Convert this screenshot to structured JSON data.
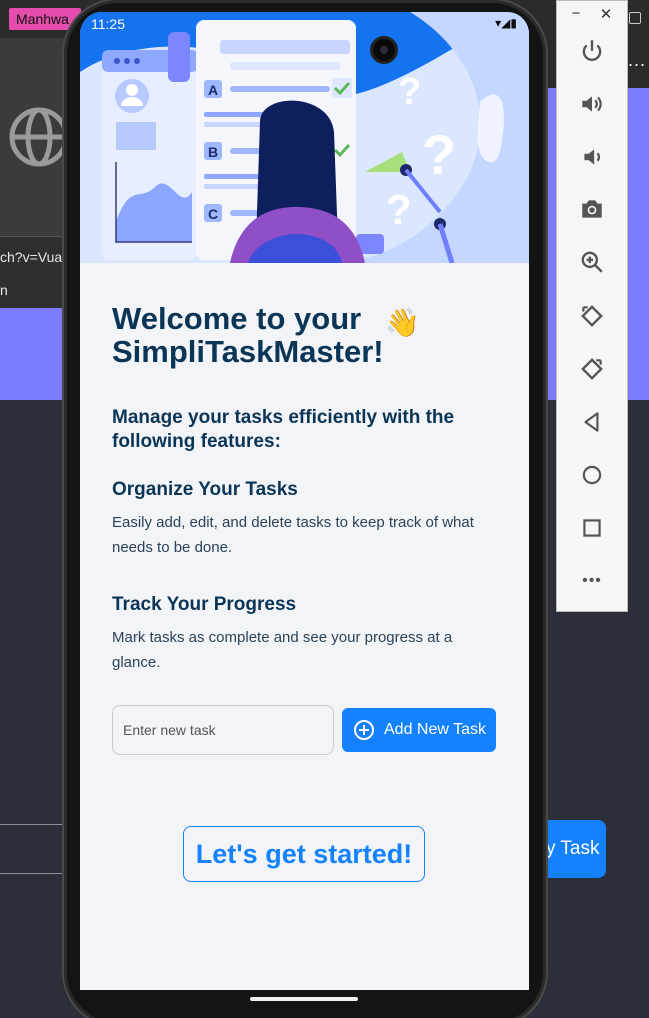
{
  "background": {
    "tab_label": "Manhwa",
    "url_fragment": "ch?v=Vua",
    "url_fragment2": "n",
    "right_dots": "...",
    "behind_button_label": "y Task"
  },
  "emulator_toolbar": {
    "minimize_label": "−",
    "close_label": "✕",
    "buttons": [
      "power-icon",
      "volume-up-icon",
      "volume-down-icon",
      "camera-icon",
      "zoom-icon",
      "rotate-left-icon",
      "rotate-right-icon",
      "back-icon",
      "home-icon",
      "overview-icon",
      "more-icon"
    ],
    "more_label": "•••"
  },
  "status_bar": {
    "time": "11:25",
    "signal": "▾◢▮"
  },
  "hero_illustration": {
    "letters": [
      "A",
      "B",
      "C"
    ],
    "question_marks": [
      "?",
      "?",
      "?"
    ]
  },
  "welcome": {
    "title": "Welcome to your SimpliTaskMaster!",
    "emoji": "👋",
    "subheading": "Manage your tasks efficiently with the following features:"
  },
  "features": [
    {
      "title": "Organize Your Tasks",
      "description": "Easily add, edit, and delete tasks to keep track of what needs to be done."
    },
    {
      "title": "Track Your Progress",
      "description": "Mark tasks as complete and see your progress at a glance."
    }
  ],
  "task_form": {
    "input_placeholder": "Enter new task",
    "input_value": "",
    "add_button_label": "Add New Task"
  },
  "start_button_label": "Let's get started!",
  "colors": {
    "accent": "#1482ff",
    "heading": "#0b3556",
    "hero_bg": "#1673f0",
    "screen_bg": "#f3f4f8"
  }
}
